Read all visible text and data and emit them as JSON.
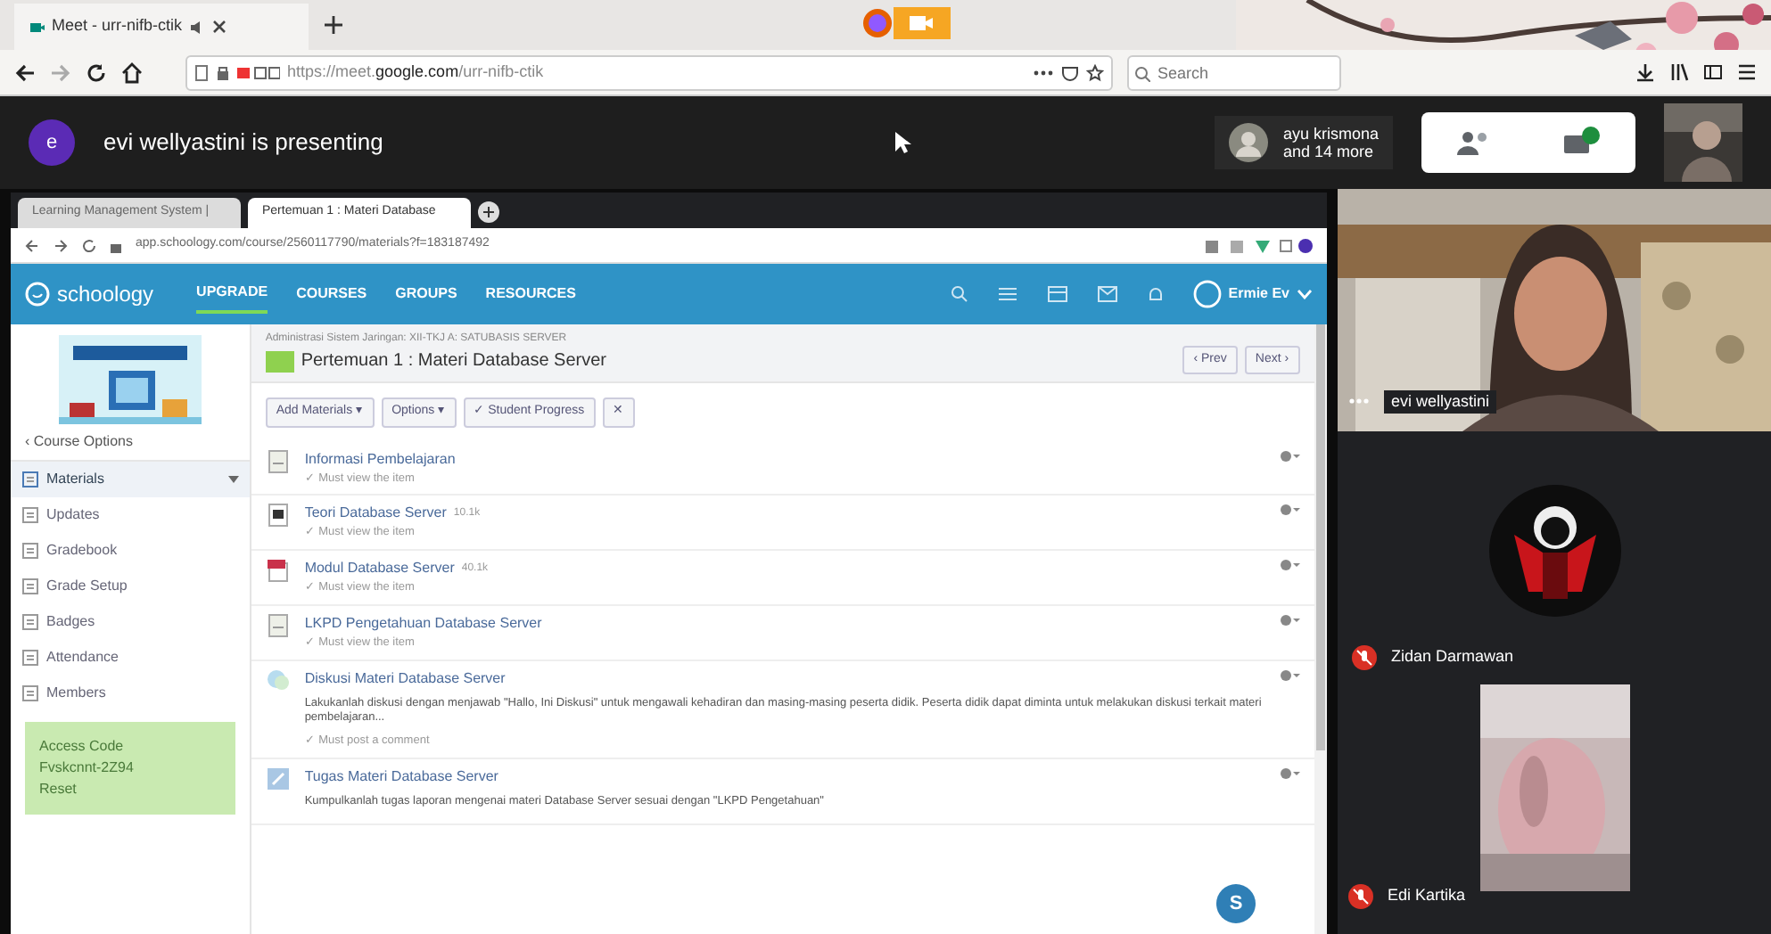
{
  "browser": {
    "tab_title": "Meet - urr-nifb-ctik",
    "url_prefix": "https://meet.",
    "url_domain": "google.com",
    "url_suffix": "/urr-nifb-ctik",
    "search_placeholder": "Search"
  },
  "meet_bar": {
    "presenter_initial": "e",
    "presenting_text": "evi wellyastini is presenting",
    "participant_name": "ayu krismona",
    "participant_more": "and 14 more"
  },
  "shared_browser": {
    "tabs": [
      {
        "title": "Learning Management System |",
        "selected": false
      },
      {
        "title": "Pertemuan 1 : Materi Database",
        "selected": true
      }
    ],
    "url": "app.schoology.com/course/2560117790/materials?f=183187492"
  },
  "schoology": {
    "logo": "schoology",
    "nav": [
      {
        "label": "UPGRADE",
        "selected": true
      },
      {
        "label": "COURSES",
        "selected": false
      },
      {
        "label": "GROUPS",
        "selected": false
      },
      {
        "label": "RESOURCES",
        "selected": false
      }
    ],
    "user": "Ermie Ev"
  },
  "sidebar": {
    "course_options": "‹ Course Options",
    "items": [
      {
        "label": "Materials",
        "selected": true
      },
      {
        "label": "Updates",
        "selected": false
      },
      {
        "label": "Gradebook",
        "selected": false
      },
      {
        "label": "Grade Setup",
        "selected": false
      },
      {
        "label": "Badges",
        "selected": false
      },
      {
        "label": "Attendance",
        "selected": false
      },
      {
        "label": "Members",
        "selected": false
      }
    ],
    "access_title": "Access Code",
    "access_code": "Fvskcnnt-2Z94",
    "access_action": "Reset"
  },
  "page": {
    "breadcrumb": "Administrasi Sistem Jaringan: XII-TKJ A: SATUBASIS SERVER",
    "title": "Pertemuan 1 : Materi Database Server",
    "prev": "‹ Prev",
    "next": "Next ›",
    "toolbar": [
      "Add Materials ▾",
      "Options ▾",
      "✓ Student Progress",
      "✕"
    ]
  },
  "materials": [
    {
      "kind": "page",
      "title": "Informasi Pembelajaran",
      "note": "✓ Must view the item"
    },
    {
      "kind": "file",
      "title": "Teori Database Server",
      "size": "10.1k",
      "note": "✓ Must view the item"
    },
    {
      "kind": "pdf",
      "title": "Modul Database Server",
      "size": "40.1k",
      "note": "✓ Must view the item"
    },
    {
      "kind": "page",
      "title": "LKPD Pengetahuan Database Server",
      "note": "✓ Must view the item"
    },
    {
      "kind": "discussion",
      "title": "Diskusi Materi Database Server",
      "description": "Lakukanlah diskusi dengan menjawab \"Hallo, Ini Diskusi\" untuk mengawali kehadiran dan masing-masing peserta didik. Peserta didik dapat diminta untuk melakukan diskusi terkait materi pembelajaran...",
      "note": "✓ Must post a comment"
    },
    {
      "kind": "assignment",
      "title": "Tugas Materi Database Server",
      "description": "Kumpulkanlah tugas laporan mengenai materi Database Server sesuai dengan \"LKPD Pengetahuan\""
    }
  ],
  "help_button": "S",
  "participants": [
    {
      "kind": "presenter",
      "name": "evi wellyastini"
    },
    {
      "kind": "avatar",
      "name": "Zidan Darmawan"
    },
    {
      "kind": "video",
      "name": "Edi Kartika"
    }
  ]
}
